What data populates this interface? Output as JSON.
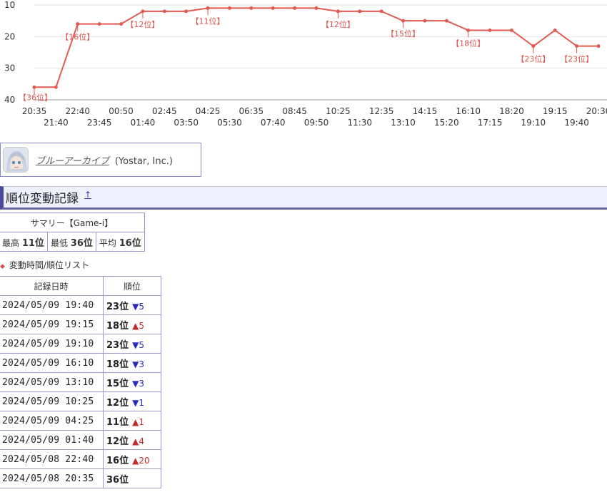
{
  "chart_data": {
    "type": "line",
    "x_top": [
      "20:35",
      "22:40",
      "00:50",
      "02:45",
      "04:25",
      "06:35",
      "08:45",
      "10:25",
      "12:35",
      "14:15",
      "16:10",
      "18:20",
      "19:15",
      "20:30"
    ],
    "x_bottom": [
      "21:40",
      "23:45",
      "01:40",
      "03:50",
      "05:30",
      "07:40",
      "09:50",
      "11:30",
      "13:10",
      "15:20",
      "17:15",
      "19:10",
      "19:40"
    ],
    "y_ticks": [
      10,
      20,
      30,
      40
    ],
    "ylim": [
      10,
      40
    ],
    "y_reversed": true,
    "values": [
      36,
      36,
      16,
      16,
      16,
      12,
      12,
      12,
      11,
      11,
      11,
      11,
      11,
      11,
      12,
      12,
      12,
      15,
      15,
      15,
      18,
      18,
      18,
      23,
      18,
      23,
      23
    ],
    "labels": [
      {
        "i": 0,
        "text": "【36位】"
      },
      {
        "i": 2,
        "text": "【16位】"
      },
      {
        "i": 5,
        "text": "【12位】"
      },
      {
        "i": 8,
        "text": "【11位】"
      },
      {
        "i": 14,
        "text": "【12位】"
      },
      {
        "i": 17,
        "text": "【15位】"
      },
      {
        "i": 20,
        "text": "【18位】"
      },
      {
        "i": 23,
        "text": "【23位】"
      },
      {
        "i": 25,
        "text": "【23位】"
      }
    ],
    "line_color": "#e05a4f"
  },
  "app": {
    "name": "ブルーアーカイブ",
    "publisher": "(Yostar, Inc.)",
    "icon": "character-avatar-icon"
  },
  "section": {
    "title": "順位変動記録",
    "up_link": "↑"
  },
  "summary": {
    "caption": "サマリー【Game-i】",
    "best_label": "最高",
    "best_value": "11位",
    "worst_label": "最低",
    "worst_value": "36位",
    "avg_label": "平均",
    "avg_value": "16位"
  },
  "list_label": "変動時間/順位リスト",
  "history": {
    "headers": [
      "記録日時",
      "順位"
    ],
    "rows": [
      {
        "date": "2024/05/09 19:40",
        "rank": "23位",
        "arrow": "▼",
        "delta": "5",
        "dir": "down"
      },
      {
        "date": "2024/05/09 19:15",
        "rank": "18位",
        "arrow": "▲",
        "delta": "5",
        "dir": "up"
      },
      {
        "date": "2024/05/09 19:10",
        "rank": "23位",
        "arrow": "▼",
        "delta": "5",
        "dir": "down"
      },
      {
        "date": "2024/05/09 16:10",
        "rank": "18位",
        "arrow": "▼",
        "delta": "3",
        "dir": "down"
      },
      {
        "date": "2024/05/09 13:10",
        "rank": "15位",
        "arrow": "▼",
        "delta": "3",
        "dir": "down"
      },
      {
        "date": "2024/05/09 10:25",
        "rank": "12位",
        "arrow": "▼",
        "delta": "1",
        "dir": "down"
      },
      {
        "date": "2024/05/09 04:25",
        "rank": "11位",
        "arrow": "▲",
        "delta": "1",
        "dir": "up"
      },
      {
        "date": "2024/05/09 01:40",
        "rank": "12位",
        "arrow": "▲",
        "delta": "4",
        "dir": "up"
      },
      {
        "date": "2024/05/08 22:40",
        "rank": "16位",
        "arrow": "▲",
        "delta": "20",
        "dir": "up"
      },
      {
        "date": "2024/05/08 20:35",
        "rank": "36位",
        "arrow": "",
        "delta": "",
        "dir": ""
      }
    ]
  }
}
